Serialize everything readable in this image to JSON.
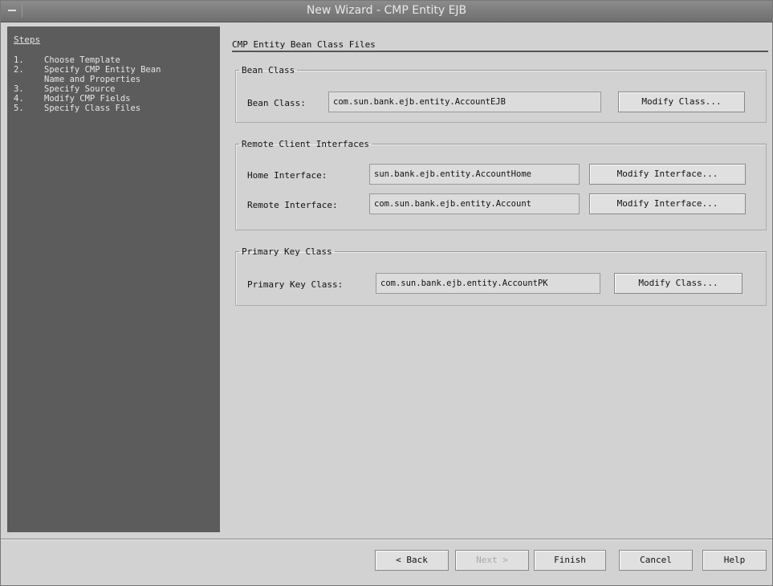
{
  "window": {
    "title": "New Wizard - CMP Entity EJB"
  },
  "steps": {
    "title": "Steps",
    "items": [
      {
        "num": "1.",
        "label": "Choose Template"
      },
      {
        "num": "2.",
        "label": "Specify CMP Entity Bean"
      },
      {
        "num": "",
        "label": "Name and Properties"
      },
      {
        "num": "3.",
        "label": "Specify Source"
      },
      {
        "num": "4.",
        "label": "Modify CMP Fields"
      },
      {
        "num": "5.",
        "label": "Specify Class Files"
      }
    ]
  },
  "content": {
    "title": "CMP Entity Bean Class Files",
    "bean_class": {
      "legend": "Bean Class",
      "label": "Bean Class:",
      "value": "com.sun.bank.ejb.entity.AccountEJB",
      "button": "Modify Class..."
    },
    "remote": {
      "legend": "Remote Client Interfaces",
      "home_label": "Home Interface:",
      "home_value": "sun.bank.ejb.entity.AccountHome",
      "home_button": "Modify Interface...",
      "remote_label": "Remote Interface:",
      "remote_value": "com.sun.bank.ejb.entity.Account",
      "remote_button": "Modify Interface..."
    },
    "pk": {
      "legend": "Primary Key Class",
      "label": "Primary Key Class:",
      "value": "com.sun.bank.ejb.entity.AccountPK",
      "button": "Modify Class..."
    }
  },
  "footer": {
    "back": "< Back",
    "next": "Next >",
    "finish": "Finish",
    "cancel": "Cancel",
    "help": "Help"
  }
}
